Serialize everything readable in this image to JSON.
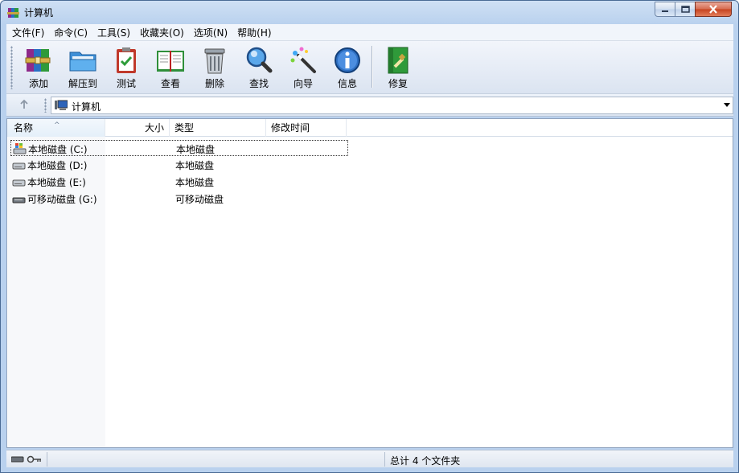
{
  "window": {
    "title": "计算机",
    "close_color": "#c6421f"
  },
  "menu": {
    "items": [
      {
        "label": "文件(F)"
      },
      {
        "label": "命令(C)"
      },
      {
        "label": "工具(S)"
      },
      {
        "label": "收藏夹(O)"
      },
      {
        "label": "选项(N)"
      },
      {
        "label": "帮助(H)"
      }
    ]
  },
  "toolbar": {
    "buttons": [
      {
        "label": "添加",
        "icon": "add-archive-icon"
      },
      {
        "label": "解压到",
        "icon": "extract-folder-icon"
      },
      {
        "label": "测试",
        "icon": "test-clipboard-icon"
      },
      {
        "label": "查看",
        "icon": "view-book-icon"
      },
      {
        "label": "删除",
        "icon": "trash-icon"
      },
      {
        "label": "查找",
        "icon": "magnifier-icon"
      },
      {
        "label": "向导",
        "icon": "wizard-wand-icon"
      },
      {
        "label": "信息",
        "icon": "info-icon"
      },
      {
        "label": "修复",
        "icon": "repair-icon"
      }
    ]
  },
  "address": {
    "path": "计算机",
    "icon": "computer-icon"
  },
  "columns": {
    "name": "名称",
    "size": "大小",
    "type": "类型",
    "modified": "修改时间"
  },
  "files": [
    {
      "name": "本地磁盘 (C:)",
      "size": "",
      "type": "本地磁盘",
      "modified": "",
      "icon": "system-drive-icon"
    },
    {
      "name": "本地磁盘 (D:)",
      "size": "",
      "type": "本地磁盘",
      "modified": "",
      "icon": "hard-drive-icon"
    },
    {
      "name": "本地磁盘 (E:)",
      "size": "",
      "type": "本地磁盘",
      "modified": "",
      "icon": "hard-drive-icon"
    },
    {
      "name": "可移动磁盘 (G:)",
      "size": "",
      "type": "可移动磁盘",
      "modified": "",
      "icon": "removable-drive-icon"
    }
  ],
  "status": {
    "summary": "总计 4 个文件夹",
    "icons": [
      "drive-status-icon",
      "key-icon"
    ]
  }
}
